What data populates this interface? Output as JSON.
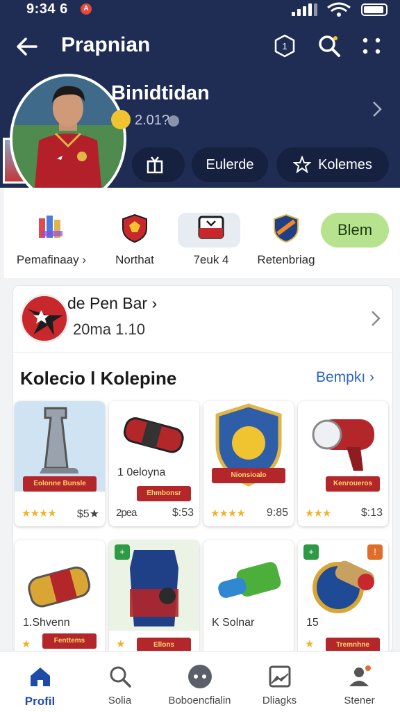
{
  "status_bar": {
    "time": "9:34 6",
    "notification_glyph": "A"
  },
  "header": {
    "title": "Prapnian",
    "profile_name": "Binidtidan",
    "profile_code": "2.01?",
    "pills": [
      {
        "label": "",
        "icon": "gift-icon"
      },
      {
        "label": "Eulerde",
        "icon": ""
      },
      {
        "label": "Kolemes",
        "icon": "star-icon"
      }
    ]
  },
  "categories": [
    {
      "label": "Pemafinaay",
      "chevron": "›",
      "icon": "mosaic-icon"
    },
    {
      "label": "Northat",
      "icon": "shield-icon"
    },
    {
      "label": "7euk 4",
      "icon": "jersey-icon",
      "selected": true
    },
    {
      "label": "Retenbriag",
      "icon": "crest-icon"
    }
  ],
  "category_button": "Blem",
  "club": {
    "name": "de Pen Bar",
    "name_chevron": "›",
    "meta": "20ma  1.10"
  },
  "collection": {
    "title": "Kolecio l Kolepine",
    "link_label": "Bempkı",
    "link_chevron": "›",
    "items": [
      {
        "name": "",
        "ribbon": "Eolonne Bunsle",
        "stars": "★★★★",
        "price": "$5★",
        "art": "boot"
      },
      {
        "name": "1 0eloyna",
        "ribbon": "Ehmbonsr",
        "stars": "2pea",
        "price": "$:53",
        "art": "tube"
      },
      {
        "name": "",
        "ribbon": "Nionsioalo",
        "stars": "★★★★",
        "price": "9:85",
        "art": "badge"
      },
      {
        "name": "",
        "ribbon": "Kenroueros",
        "stars": "★★★",
        "price": "$:13",
        "art": "blaster"
      },
      {
        "name": "1.Shvenn",
        "ribbon": "Fenttems",
        "stars": "★",
        "price": "",
        "art": "roller"
      },
      {
        "name": "",
        "ribbon": "Ellons",
        "stars": "★",
        "price": "",
        "art": "shirt"
      },
      {
        "name": "K  Solnar",
        "ribbon": "",
        "stars": "",
        "price": "",
        "art": "cannon"
      },
      {
        "name": "15",
        "ribbon": "Tremnhne",
        "stars": "★",
        "price": "",
        "art": "wheel"
      }
    ]
  },
  "bottom_nav": [
    {
      "label": "Profil",
      "icon": "home-icon",
      "active": true
    },
    {
      "label": "Solia",
      "icon": "search-icon"
    },
    {
      "label": "Boboencfialin",
      "icon": "chat-icon"
    },
    {
      "label": "Dliagks",
      "icon": "image-icon"
    },
    {
      "label": "Stener",
      "icon": "user-icon"
    }
  ],
  "colors": {
    "header_bg": "#1f2d55",
    "pill_bg": "#16203f",
    "accent_green": "#b7e38e",
    "link_blue": "#2a64c4",
    "star": "#f0b32a"
  }
}
